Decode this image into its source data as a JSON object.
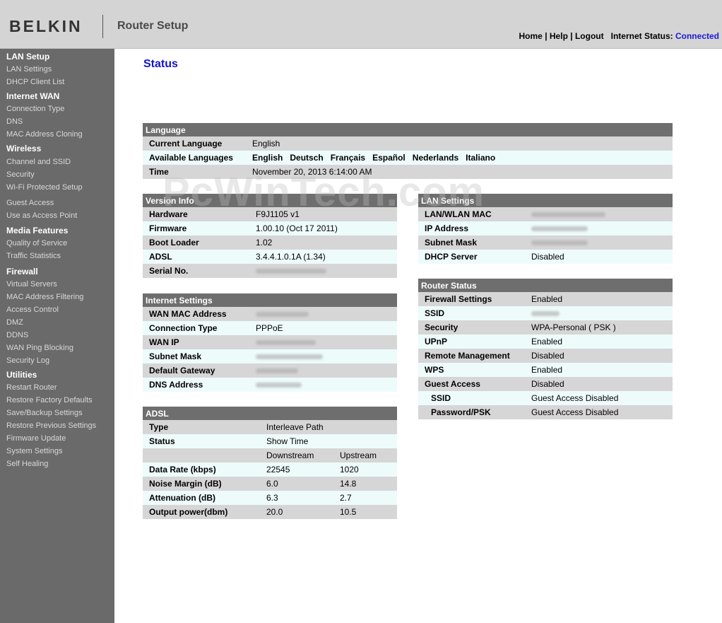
{
  "header": {
    "logo": "BELKIN",
    "title": "Router Setup",
    "links": {
      "home": "Home",
      "help": "Help",
      "logout": "Logout",
      "sep": "|"
    },
    "internet_status_label": "Internet Status:",
    "internet_status_value": "Connected"
  },
  "sidebar": {
    "lan_setup": {
      "title": "LAN Setup",
      "items": [
        "LAN Settings",
        "DHCP Client List"
      ]
    },
    "internet_wan": {
      "title": "Internet WAN",
      "items": [
        "Connection Type",
        "DNS",
        "MAC Address Cloning"
      ]
    },
    "wireless": {
      "title": "Wireless",
      "items": [
        "Channel and SSID",
        "Security",
        "Wi-Fi Protected Setup",
        "Guest Access",
        "Use as Access Point"
      ]
    },
    "media": {
      "title": "Media Features",
      "items": [
        "Quality of Service",
        "Traffic Statistics"
      ]
    },
    "firewall": {
      "title": "Firewall",
      "items": [
        "Virtual Servers",
        "MAC Address Filtering",
        "Access Control",
        "DMZ",
        "DDNS",
        "WAN Ping Blocking",
        "Security Log"
      ]
    },
    "utilities": {
      "title": "Utilities",
      "items": [
        "Restart Router",
        "Restore Factory Defaults",
        "Save/Backup Settings",
        "Restore Previous Settings",
        "Firmware Update",
        "System Settings",
        "Self Healing"
      ]
    }
  },
  "main": {
    "title": "Status",
    "watermark": "PcWinTech.com",
    "language": {
      "header": "Language",
      "current_label": "Current Language",
      "current_value": "English",
      "available_label": "Available Languages",
      "available_values": [
        "English",
        "Deutsch",
        "Français",
        "Español",
        "Nederlands",
        "Italiano"
      ],
      "time_label": "Time",
      "time_value": "November 20, 2013  6:14:00 AM"
    },
    "version": {
      "header": "Version Info",
      "rows": [
        {
          "label": "Hardware",
          "value": "F9J1105 v1"
        },
        {
          "label": "Firmware",
          "value": "1.00.10 (Oct 17 2011)"
        },
        {
          "label": "Boot Loader",
          "value": "1.02"
        },
        {
          "label": "ADSL",
          "value": "3.4.4.1.0.1A (1.34)"
        },
        {
          "label": "Serial No.",
          "value": ""
        }
      ]
    },
    "internet": {
      "header": "Internet Settings",
      "rows": [
        {
          "label": "WAN MAC Address",
          "value": ""
        },
        {
          "label": "Connection Type",
          "value": "PPPoE"
        },
        {
          "label": "WAN IP",
          "value": ""
        },
        {
          "label": "Subnet Mask",
          "value": ""
        },
        {
          "label": "Default Gateway",
          "value": ""
        },
        {
          "label": "DNS Address",
          "value": ""
        }
      ]
    },
    "adsl": {
      "header": "ADSL",
      "type_label": "Type",
      "type_value": "Interleave Path",
      "status_label": "Status",
      "status_value": "Show Time",
      "col_down": "Downstream",
      "col_up": "Upstream",
      "rows": [
        {
          "label": "Data Rate (kbps)",
          "down": "22545",
          "up": "1020"
        },
        {
          "label": "Noise Margin (dB)",
          "down": "6.0",
          "up": "14.8"
        },
        {
          "label": "Attenuation (dB)",
          "down": "6.3",
          "up": "2.7"
        },
        {
          "label": "Output power(dbm)",
          "down": "20.0",
          "up": "10.5"
        }
      ]
    },
    "lan": {
      "header": "LAN Settings",
      "rows": [
        {
          "label": "LAN/WLAN MAC",
          "value": ""
        },
        {
          "label": "IP Address",
          "value": ""
        },
        {
          "label": "Subnet Mask",
          "value": ""
        },
        {
          "label": "DHCP Server",
          "value": "Disabled"
        }
      ]
    },
    "router": {
      "header": "Router Status",
      "rows": [
        {
          "label": "Firewall Settings",
          "value": "Enabled"
        },
        {
          "label": "SSID",
          "value": ""
        },
        {
          "label": "Security",
          "value": "WPA-Personal ( PSK )"
        },
        {
          "label": "UPnP",
          "value": "Enabled"
        },
        {
          "label": "Remote Management",
          "value": "Disabled"
        },
        {
          "label": "WPS",
          "value": "Enabled"
        },
        {
          "label": "Guest Access",
          "value": "Disabled"
        },
        {
          "label": "SSID",
          "value": "Guest Access Disabled"
        },
        {
          "label": "Password/PSK",
          "value": "Guest Access Disabled"
        }
      ]
    }
  }
}
